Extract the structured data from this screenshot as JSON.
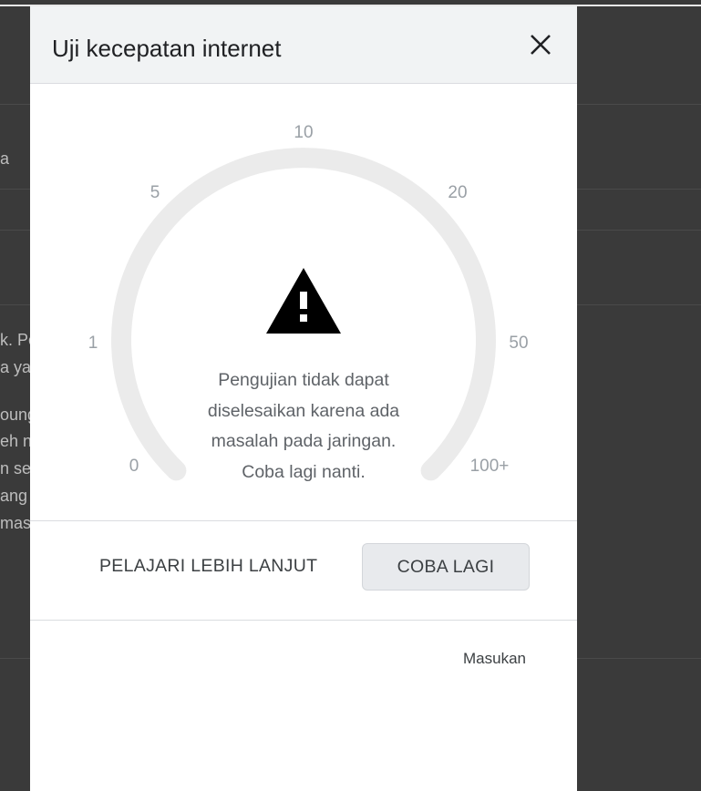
{
  "dialog": {
    "title": "Uji kecepatan internet",
    "error_message_lines": [
      "Pengujian tidak dapat",
      "diselesaikan karena ada",
      "masalah pada jaringan.",
      "Coba lagi nanti."
    ],
    "learn_more_label": "PELAJARI LEBIH LANJUT",
    "retry_label": "COBA LAGI",
    "feedback_label": "Masukan"
  },
  "gauge": {
    "scale_labels": [
      "0",
      "1",
      "5",
      "10",
      "20",
      "50",
      "100+"
    ],
    "track_color": "#ebebeb",
    "status_icon": "warning-icon"
  },
  "background": {
    "text_fragments": [
      "a",
      "k. Pe",
      "a ya",
      "oung",
      "eh n",
      "n se",
      "ang",
      "mas"
    ]
  },
  "colors": {
    "overlay": "#3a3a3a",
    "header_bg": "#f1f3f4",
    "button_bg": "#e8eaed"
  }
}
